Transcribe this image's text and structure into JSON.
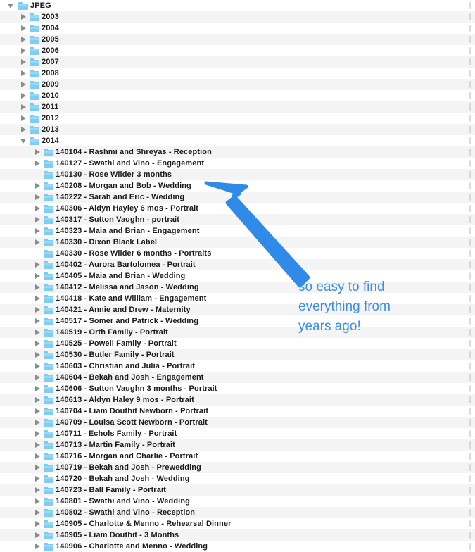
{
  "window": {
    "title": "JPEG",
    "accent_blue": "#3a8ee6",
    "folder_blue": "#7ecdf2",
    "row_alt_color": "#f4f4f4",
    "row_base_color": "#ffffff"
  },
  "annotation": {
    "arrow_icon": "arrow-pointer-up-left-icon",
    "arrow_color": "#2f8ae8",
    "lines": [
      "so easy to find",
      "everything from",
      "years ago!"
    ]
  },
  "tree": {
    "root_icon": "folder-icon",
    "rows": [
      {
        "label": "JPEG",
        "depth": 0,
        "state": "open",
        "icon": "folder-icon"
      },
      {
        "label": "2003",
        "depth": 1,
        "state": "closed",
        "icon": "folder-icon"
      },
      {
        "label": "2004",
        "depth": 1,
        "state": "closed",
        "icon": "folder-icon"
      },
      {
        "label": "2005",
        "depth": 1,
        "state": "closed",
        "icon": "folder-icon"
      },
      {
        "label": "2006",
        "depth": 1,
        "state": "closed",
        "icon": "folder-icon"
      },
      {
        "label": "2007",
        "depth": 1,
        "state": "closed",
        "icon": "folder-icon"
      },
      {
        "label": "2008",
        "depth": 1,
        "state": "closed",
        "icon": "folder-icon"
      },
      {
        "label": "2009",
        "depth": 1,
        "state": "closed",
        "icon": "folder-icon"
      },
      {
        "label": "2010",
        "depth": 1,
        "state": "closed",
        "icon": "folder-icon"
      },
      {
        "label": "2011",
        "depth": 1,
        "state": "closed",
        "icon": "folder-icon"
      },
      {
        "label": "2012",
        "depth": 1,
        "state": "closed",
        "icon": "folder-icon"
      },
      {
        "label": "2013",
        "depth": 1,
        "state": "closed",
        "icon": "folder-icon"
      },
      {
        "label": "2014",
        "depth": 1,
        "state": "open",
        "icon": "folder-icon"
      },
      {
        "label": "140104 - Rashmi and Shreyas - Reception",
        "depth": 2,
        "state": "closed",
        "icon": "folder-icon"
      },
      {
        "label": "140127 - Swathi and Vino - Engagement",
        "depth": 2,
        "state": "closed",
        "icon": "folder-icon"
      },
      {
        "label": "140130 - Rose Wilder 3 months",
        "depth": 2,
        "state": "leaf",
        "icon": "folder-icon"
      },
      {
        "label": "140208 - Morgan and Bob - Wedding",
        "depth": 2,
        "state": "closed",
        "icon": "folder-icon"
      },
      {
        "label": "140222 - Sarah and Eric - Wedding",
        "depth": 2,
        "state": "closed",
        "icon": "folder-icon"
      },
      {
        "label": "140306 - Aldyn Hayley 6 mos - Portrait",
        "depth": 2,
        "state": "closed",
        "icon": "folder-icon"
      },
      {
        "label": "140317 - Sutton Vaughn - portrait",
        "depth": 2,
        "state": "closed",
        "icon": "folder-icon"
      },
      {
        "label": "140323 - Maia and Brian - Engagement",
        "depth": 2,
        "state": "closed",
        "icon": "folder-icon"
      },
      {
        "label": "140330 - Dixon Black Label",
        "depth": 2,
        "state": "closed",
        "icon": "folder-icon"
      },
      {
        "label": "140330 - Rose Wilder 6 months - Portraits",
        "depth": 2,
        "state": "leaf",
        "icon": "folder-icon"
      },
      {
        "label": "140402 - Aurora Bartolomea - Portrait",
        "depth": 2,
        "state": "closed",
        "icon": "folder-icon"
      },
      {
        "label": "140405 - Maia and Brian - Wedding",
        "depth": 2,
        "state": "closed",
        "icon": "folder-icon"
      },
      {
        "label": "140412 - Melissa and Jason - Wedding",
        "depth": 2,
        "state": "closed",
        "icon": "folder-icon"
      },
      {
        "label": "140418 - Kate and William - Engagement",
        "depth": 2,
        "state": "closed",
        "icon": "folder-icon"
      },
      {
        "label": "140421 - Annie and Drew - Maternity",
        "depth": 2,
        "state": "closed",
        "icon": "folder-icon"
      },
      {
        "label": "140517 - Somer and Patrick - Wedding",
        "depth": 2,
        "state": "closed",
        "icon": "folder-icon"
      },
      {
        "label": "140519 - Orth Family - Portrait",
        "depth": 2,
        "state": "closed",
        "icon": "folder-icon"
      },
      {
        "label": "140525 - Powell Family - Portrait",
        "depth": 2,
        "state": "closed",
        "icon": "folder-icon"
      },
      {
        "label": "140530 - Butler Family - Portrait",
        "depth": 2,
        "state": "closed",
        "icon": "folder-icon"
      },
      {
        "label": "140603 - Christian and Julia - Portrait",
        "depth": 2,
        "state": "closed",
        "icon": "folder-icon"
      },
      {
        "label": "140604 - Bekah and Josh - Engagement",
        "depth": 2,
        "state": "closed",
        "icon": "folder-icon"
      },
      {
        "label": "140606 - Sutton Vaughn 3 months - Portrait",
        "depth": 2,
        "state": "closed",
        "icon": "folder-icon"
      },
      {
        "label": "140613 - Aldyn Haley 9 mos - Portrait",
        "depth": 2,
        "state": "closed",
        "icon": "folder-icon"
      },
      {
        "label": "140704 - Liam Douthit Newborn - Portrait",
        "depth": 2,
        "state": "closed",
        "icon": "folder-icon"
      },
      {
        "label": "140709 - Louisa Scott Newborn - Portrait",
        "depth": 2,
        "state": "closed",
        "icon": "folder-icon"
      },
      {
        "label": "140711 - Echols Family - Portrait",
        "depth": 2,
        "state": "closed",
        "icon": "folder-icon"
      },
      {
        "label": "140713 - Martin Family - Portrait",
        "depth": 2,
        "state": "closed",
        "icon": "folder-icon"
      },
      {
        "label": "140716 - Morgan and Charlie - Portrait",
        "depth": 2,
        "state": "closed",
        "icon": "folder-icon"
      },
      {
        "label": "140719 - Bekah and Josh - Prewedding",
        "depth": 2,
        "state": "closed",
        "icon": "folder-icon"
      },
      {
        "label": "140720 - Bekah and Josh - Wedding",
        "depth": 2,
        "state": "closed",
        "icon": "folder-icon"
      },
      {
        "label": "140723 - Ball Family - Portrait",
        "depth": 2,
        "state": "closed",
        "icon": "folder-icon"
      },
      {
        "label": "140801 - Swathi and Vino - Wedding",
        "depth": 2,
        "state": "closed",
        "icon": "folder-icon"
      },
      {
        "label": "140802 - Swathi and Vino - Reception",
        "depth": 2,
        "state": "closed",
        "icon": "folder-icon"
      },
      {
        "label": "140905 - Charlotte & Menno - Rehearsal Dinner",
        "depth": 2,
        "state": "closed",
        "icon": "folder-icon"
      },
      {
        "label": "140905 - Liam Douthit - 3 Months",
        "depth": 2,
        "state": "closed",
        "icon": "folder-icon"
      },
      {
        "label": "140906 - Charlotte and Menno - Wedding",
        "depth": 2,
        "state": "closed",
        "icon": "folder-icon"
      }
    ]
  }
}
